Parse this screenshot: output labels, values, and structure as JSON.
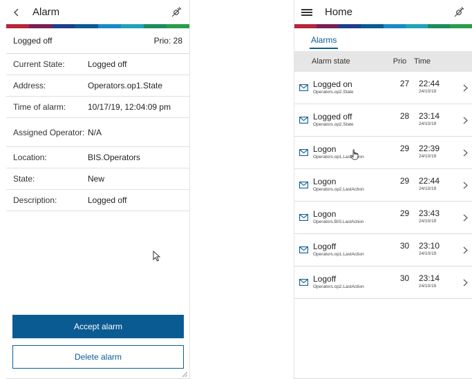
{
  "colors": {
    "accent": "#0b5b93",
    "rainbow": [
      "#b7253b",
      "#7a1f56",
      "#1c3f8f",
      "#0b5b93",
      "#1a8ac6",
      "#1fa3b8",
      "#1c8d5e",
      "#2a9d4a"
    ]
  },
  "left": {
    "header": {
      "back_icon": "chevron-left-icon",
      "title": "Alarm",
      "status_icon": "plug-disconnected-icon"
    },
    "summary": {
      "state": "Logged off",
      "prio": "Prio: 28"
    },
    "details": [
      {
        "label": "Current State:",
        "value": "Logged off"
      },
      {
        "label": "Address:",
        "value": "Operators.op1.State"
      },
      {
        "label": "Time of alarm:",
        "value": "10/17/19, 12:04:09 pm"
      },
      {
        "label": "Assigned Operator:",
        "value": "N/A"
      },
      {
        "label": "Location:",
        "value": "BIS.Operators"
      },
      {
        "label": "State:",
        "value": "New"
      },
      {
        "label": "Description:",
        "value": "Logged off"
      }
    ],
    "accept_label": "Accept alarm",
    "delete_label": "Delete alarm"
  },
  "right": {
    "header": {
      "menu_icon": "hamburger-menu-icon",
      "title": "Home",
      "status_icon": "plug-disconnected-icon"
    },
    "tab": "Alarms",
    "columns": {
      "state": "Alarm state",
      "prio": "Prio",
      "time": "Time"
    },
    "alarms": [
      {
        "name": "Logged on",
        "source": "Operators.op2.State",
        "prio": "27",
        "time": "22:44",
        "date": "24/10/19"
      },
      {
        "name": "Logged off",
        "source": "Operators.op2.State",
        "prio": "28",
        "time": "23:14",
        "date": "24/10/19"
      },
      {
        "name": "Logon",
        "source": "Operators.op1.LastAction",
        "prio": "29",
        "time": "22:39",
        "date": "24/10/19"
      },
      {
        "name": "Logon",
        "source": "Operators.op2.LastAction",
        "prio": "29",
        "time": "22:44",
        "date": "24/10/19"
      },
      {
        "name": "Logon",
        "source": "Operators.BIS.LastAction",
        "prio": "29",
        "time": "23:43",
        "date": "24/10/19"
      },
      {
        "name": "Logoff",
        "source": "Operators.op1.LastAction",
        "prio": "30",
        "time": "23:10",
        "date": "24/10/19"
      },
      {
        "name": "Logoff",
        "source": "Operators.op2.LastAction",
        "prio": "30",
        "time": "23:14",
        "date": "24/10/19"
      }
    ]
  }
}
